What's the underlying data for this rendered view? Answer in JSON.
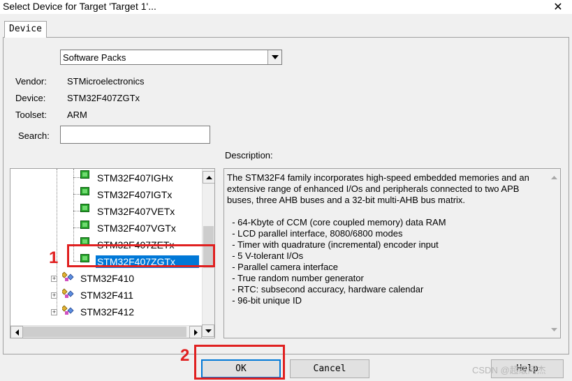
{
  "window": {
    "title": "Select Device for Target 'Target 1'...",
    "close_glyph": "✕"
  },
  "tab": {
    "label": "Device"
  },
  "source_combo": {
    "value": "Software Packs"
  },
  "info": {
    "vendor_label": "Vendor:",
    "vendor_value": "STMicroelectronics",
    "device_label": "Device:",
    "device_value": "STM32F407ZGTx",
    "toolset_label": "Toolset:",
    "toolset_value": "ARM",
    "search_label": "Search:",
    "search_value": ""
  },
  "description": {
    "label": "Description:",
    "text": "The STM32F4 family incorporates high-speed embedded memories and an extensive range of enhanced I/Os and peripherals connected to two APB buses, three AHB buses and a 32-bit multi-AHB bus matrix.\n\n  - 64-Kbyte of CCM (core coupled memory) data RAM\n  - LCD parallel interface, 8080/6800 modes\n  - Timer with quadrature (incremental) encoder input\n  - 5 V-tolerant I/Os\n  - Parallel camera interface\n  - True random number generator\n  - RTC: subsecond accuracy, hardware calendar\n  - 96-bit unique ID"
  },
  "tree": {
    "devices": [
      {
        "label": "STM32F407IGHx"
      },
      {
        "label": "STM32F407IGTx"
      },
      {
        "label": "STM32F407VETx"
      },
      {
        "label": "STM32F407VGTx"
      },
      {
        "label": "STM32F407ZETx"
      },
      {
        "label": "STM32F407ZGTx"
      }
    ],
    "families": [
      {
        "label": "STM32F410"
      },
      {
        "label": "STM32F411"
      },
      {
        "label": "STM32F412"
      }
    ]
  },
  "buttons": {
    "ok": "OK",
    "cancel": "Cancel",
    "help": "Help"
  },
  "annotations": {
    "marker_1": "1",
    "marker_2": "2"
  },
  "watermark": "CSDN @超级阿杰",
  "colors": {
    "selection": "#0078d7",
    "annotation_red": "#e02020",
    "chip_green": "#27a32b"
  }
}
